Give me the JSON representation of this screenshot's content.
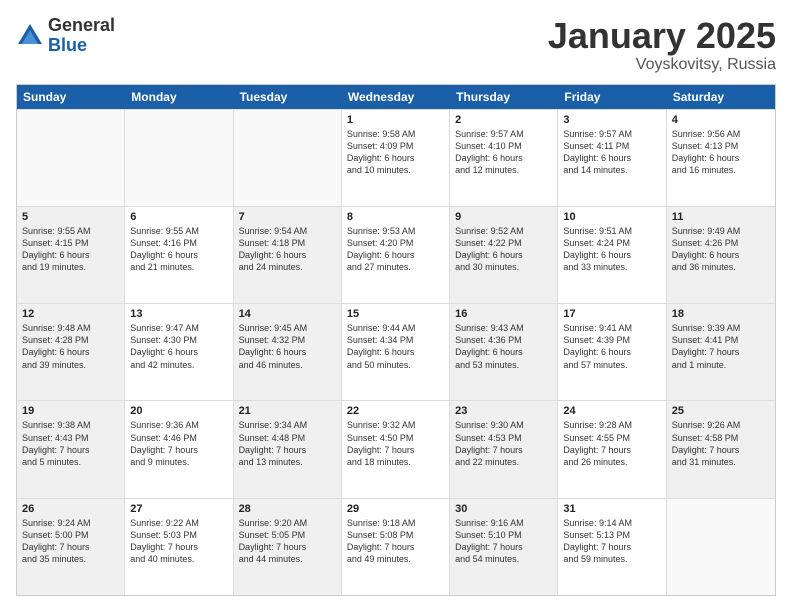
{
  "logo": {
    "general": "General",
    "blue": "Blue"
  },
  "title": "January 2025",
  "location": "Voyskovitsy, Russia",
  "days": [
    "Sunday",
    "Monday",
    "Tuesday",
    "Wednesday",
    "Thursday",
    "Friday",
    "Saturday"
  ],
  "rows": [
    [
      {
        "day": "",
        "info": "",
        "empty": true
      },
      {
        "day": "",
        "info": "",
        "empty": true
      },
      {
        "day": "",
        "info": "",
        "empty": true
      },
      {
        "day": "1",
        "info": "Sunrise: 9:58 AM\nSunset: 4:09 PM\nDaylight: 6 hours\nand 10 minutes."
      },
      {
        "day": "2",
        "info": "Sunrise: 9:57 AM\nSunset: 4:10 PM\nDaylight: 6 hours\nand 12 minutes."
      },
      {
        "day": "3",
        "info": "Sunrise: 9:57 AM\nSunset: 4:11 PM\nDaylight: 6 hours\nand 14 minutes."
      },
      {
        "day": "4",
        "info": "Sunrise: 9:56 AM\nSunset: 4:13 PM\nDaylight: 6 hours\nand 16 minutes."
      }
    ],
    [
      {
        "day": "5",
        "info": "Sunrise: 9:55 AM\nSunset: 4:15 PM\nDaylight: 6 hours\nand 19 minutes.",
        "shaded": true
      },
      {
        "day": "6",
        "info": "Sunrise: 9:55 AM\nSunset: 4:16 PM\nDaylight: 6 hours\nand 21 minutes."
      },
      {
        "day": "7",
        "info": "Sunrise: 9:54 AM\nSunset: 4:18 PM\nDaylight: 6 hours\nand 24 minutes.",
        "shaded": true
      },
      {
        "day": "8",
        "info": "Sunrise: 9:53 AM\nSunset: 4:20 PM\nDaylight: 6 hours\nand 27 minutes."
      },
      {
        "day": "9",
        "info": "Sunrise: 9:52 AM\nSunset: 4:22 PM\nDaylight: 6 hours\nand 30 minutes.",
        "shaded": true
      },
      {
        "day": "10",
        "info": "Sunrise: 9:51 AM\nSunset: 4:24 PM\nDaylight: 6 hours\nand 33 minutes."
      },
      {
        "day": "11",
        "info": "Sunrise: 9:49 AM\nSunset: 4:26 PM\nDaylight: 6 hours\nand 36 minutes.",
        "shaded": true
      }
    ],
    [
      {
        "day": "12",
        "info": "Sunrise: 9:48 AM\nSunset: 4:28 PM\nDaylight: 6 hours\nand 39 minutes.",
        "shaded": true
      },
      {
        "day": "13",
        "info": "Sunrise: 9:47 AM\nSunset: 4:30 PM\nDaylight: 6 hours\nand 42 minutes."
      },
      {
        "day": "14",
        "info": "Sunrise: 9:45 AM\nSunset: 4:32 PM\nDaylight: 6 hours\nand 46 minutes.",
        "shaded": true
      },
      {
        "day": "15",
        "info": "Sunrise: 9:44 AM\nSunset: 4:34 PM\nDaylight: 6 hours\nand 50 minutes."
      },
      {
        "day": "16",
        "info": "Sunrise: 9:43 AM\nSunset: 4:36 PM\nDaylight: 6 hours\nand 53 minutes.",
        "shaded": true
      },
      {
        "day": "17",
        "info": "Sunrise: 9:41 AM\nSunset: 4:39 PM\nDaylight: 6 hours\nand 57 minutes."
      },
      {
        "day": "18",
        "info": "Sunrise: 9:39 AM\nSunset: 4:41 PM\nDaylight: 7 hours\nand 1 minute.",
        "shaded": true
      }
    ],
    [
      {
        "day": "19",
        "info": "Sunrise: 9:38 AM\nSunset: 4:43 PM\nDaylight: 7 hours\nand 5 minutes.",
        "shaded": true
      },
      {
        "day": "20",
        "info": "Sunrise: 9:36 AM\nSunset: 4:46 PM\nDaylight: 7 hours\nand 9 minutes."
      },
      {
        "day": "21",
        "info": "Sunrise: 9:34 AM\nSunset: 4:48 PM\nDaylight: 7 hours\nand 13 minutes.",
        "shaded": true
      },
      {
        "day": "22",
        "info": "Sunrise: 9:32 AM\nSunset: 4:50 PM\nDaylight: 7 hours\nand 18 minutes."
      },
      {
        "day": "23",
        "info": "Sunrise: 9:30 AM\nSunset: 4:53 PM\nDaylight: 7 hours\nand 22 minutes.",
        "shaded": true
      },
      {
        "day": "24",
        "info": "Sunrise: 9:28 AM\nSunset: 4:55 PM\nDaylight: 7 hours\nand 26 minutes."
      },
      {
        "day": "25",
        "info": "Sunrise: 9:26 AM\nSunset: 4:58 PM\nDaylight: 7 hours\nand 31 minutes.",
        "shaded": true
      }
    ],
    [
      {
        "day": "26",
        "info": "Sunrise: 9:24 AM\nSunset: 5:00 PM\nDaylight: 7 hours\nand 35 minutes.",
        "shaded": true
      },
      {
        "day": "27",
        "info": "Sunrise: 9:22 AM\nSunset: 5:03 PM\nDaylight: 7 hours\nand 40 minutes."
      },
      {
        "day": "28",
        "info": "Sunrise: 9:20 AM\nSunset: 5:05 PM\nDaylight: 7 hours\nand 44 minutes.",
        "shaded": true
      },
      {
        "day": "29",
        "info": "Sunrise: 9:18 AM\nSunset: 5:08 PM\nDaylight: 7 hours\nand 49 minutes."
      },
      {
        "day": "30",
        "info": "Sunrise: 9:16 AM\nSunset: 5:10 PM\nDaylight: 7 hours\nand 54 minutes.",
        "shaded": true
      },
      {
        "day": "31",
        "info": "Sunrise: 9:14 AM\nSunset: 5:13 PM\nDaylight: 7 hours\nand 59 minutes."
      },
      {
        "day": "",
        "info": "",
        "empty": true,
        "shaded": true
      }
    ]
  ]
}
